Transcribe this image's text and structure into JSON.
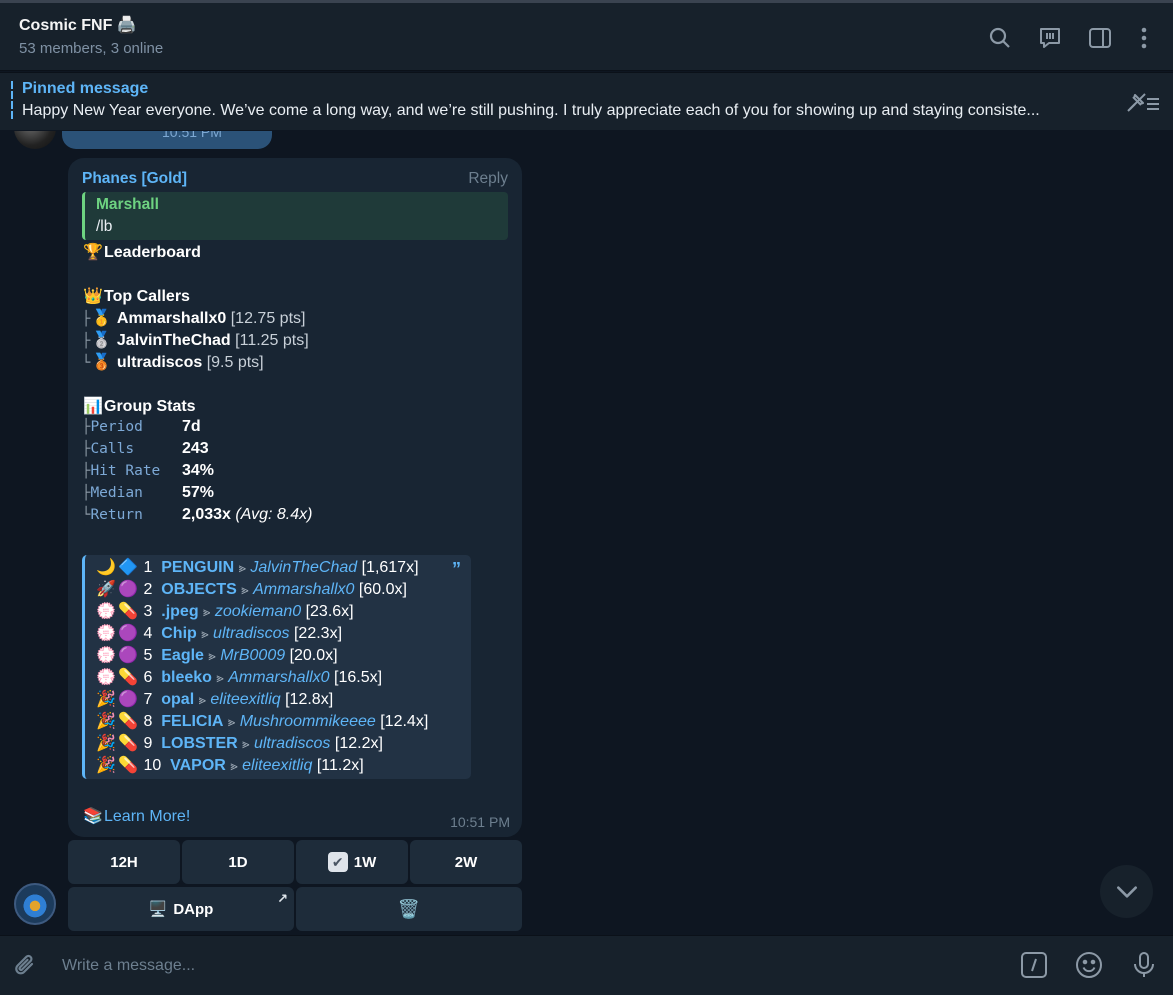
{
  "header": {
    "title": "Cosmic FNF 🖨️",
    "subtitle": "53 members, 3 online"
  },
  "pinned": {
    "label": "Pinned message",
    "text": "Happy New Year everyone. We’ve come a long way, and we’re still pushing.  I truly appreciate each of you for showing up and staying consiste..."
  },
  "previous_message": {
    "time": "10:51 PM"
  },
  "message": {
    "sender": "Phanes [Gold]",
    "reply_label": "Reply",
    "quote": {
      "name": "Marshall",
      "text": "/lb"
    },
    "leaderboard_title": "Leaderboard",
    "top_callers_title": "Top Callers",
    "callers": [
      {
        "tree": "├",
        "medal": "🥇",
        "name": "Ammarshallx0",
        "pts": "[12.75 pts]"
      },
      {
        "tree": "├",
        "medal": "🥈",
        "name": "JalvinTheChad",
        "pts": "[11.25 pts]"
      },
      {
        "tree": "└",
        "medal": "🥉",
        "name": "ultradiscos",
        "pts": "[9.5 pts]"
      }
    ],
    "group_stats_title": "Group Stats",
    "stats": [
      {
        "tree": "├",
        "label": "Period",
        "value": "7d",
        "extra": ""
      },
      {
        "tree": "├",
        "label": "Calls",
        "value": "243",
        "extra": ""
      },
      {
        "tree": "├",
        "label": "Hit Rate",
        "value": "34%",
        "extra": ""
      },
      {
        "tree": "├",
        "label": "Median",
        "value": "57%",
        "extra": ""
      },
      {
        "tree": "└",
        "label": "Return",
        "value": "2,033x",
        "extra": "(Avg: 8.4x)"
      }
    ],
    "calls": [
      {
        "e1": "🌙",
        "e2": "🔷",
        "rank": "1",
        "ticker": "PENGUIN",
        "caller": "JalvinTheChad",
        "mult": "[1,617x]"
      },
      {
        "e1": "🚀",
        "e2": "🟣",
        "rank": "2",
        "ticker": "OBJECTS",
        "caller": "Ammarshallx0",
        "mult": "[60.0x]"
      },
      {
        "e1": "💮",
        "e2": "💊",
        "rank": "3",
        "ticker": ".jpeg",
        "caller": "zookieman0",
        "mult": "[23.6x]"
      },
      {
        "e1": "💮",
        "e2": "🟣",
        "rank": "4",
        "ticker": "Chip",
        "caller": "ultradiscos",
        "mult": "[22.3x]"
      },
      {
        "e1": "💮",
        "e2": "🟣",
        "rank": "5",
        "ticker": "Eagle",
        "caller": "MrB0009",
        "mult": "[20.0x]"
      },
      {
        "e1": "💮",
        "e2": "💊",
        "rank": "6",
        "ticker": "bleeko",
        "caller": "Ammarshallx0",
        "mult": "[16.5x]"
      },
      {
        "e1": "🎉",
        "e2": "🟣",
        "rank": "7",
        "ticker": "opal",
        "caller": "eliteexitliq",
        "mult": "[12.8x]"
      },
      {
        "e1": "🎉",
        "e2": "💊",
        "rank": "8",
        "ticker": "FELICIA",
        "caller": "Mushroommikeeee",
        "mult": "[12.4x]"
      },
      {
        "e1": "🎉",
        "e2": "💊",
        "rank": "9",
        "ticker": "LOBSTER",
        "caller": "ultradiscos",
        "mult": "[12.2x]"
      },
      {
        "e1": "🎉",
        "e2": "💊",
        "rank": "10",
        "ticker": "VAPOR",
        "caller": "eliteexitliq",
        "mult": "[11.2x]"
      }
    ],
    "learn_more": "Learn More!",
    "time": "10:51 PM"
  },
  "keyboard": {
    "row1": [
      "12H",
      "1D",
      "1W",
      "2W"
    ],
    "selected_check": "✔",
    "dapp_label": "DApp"
  },
  "composer": {
    "placeholder": "Write a message..."
  },
  "icons": {
    "header": [
      "search-icon",
      "topics-icon",
      "sidebar-toggle-icon",
      "more-icon"
    ],
    "composer": [
      "attach-icon",
      "command-icon",
      "emoji-icon",
      "mic-icon"
    ]
  },
  "colors": {
    "background": "#0e1621",
    "panel": "#17212b",
    "bubble": "#182533",
    "accent": "#5eb5f7",
    "quote_green": "#6ed381"
  }
}
